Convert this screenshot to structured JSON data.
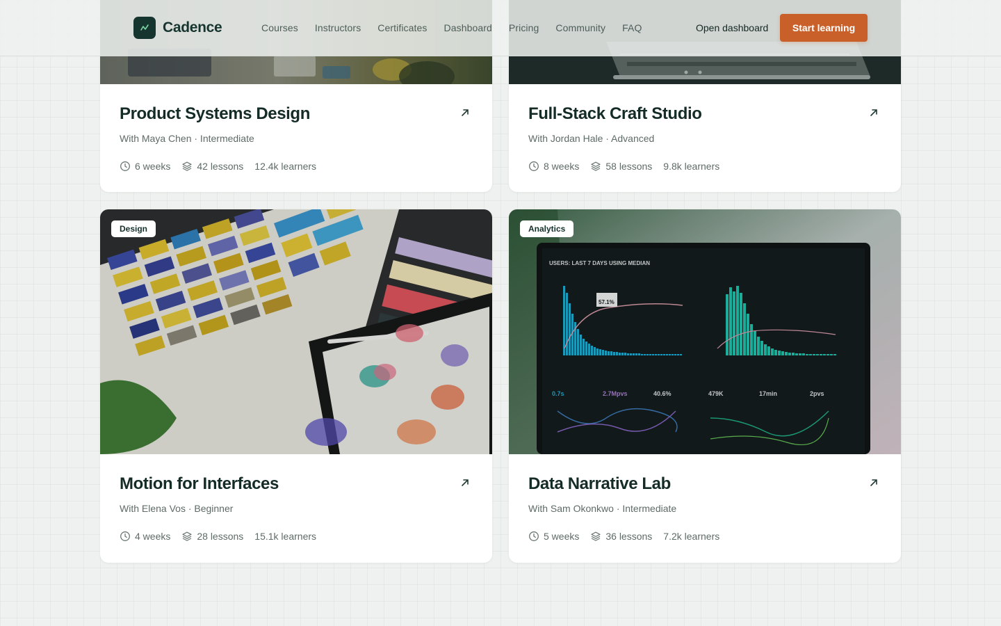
{
  "brand": {
    "name": "Cadence"
  },
  "nav": {
    "items": [
      "Courses",
      "Instructors",
      "Certificates",
      "Dashboard",
      "Pricing",
      "Community",
      "FAQ"
    ],
    "open_dashboard": "Open dashboard",
    "start_learning": "Start learning"
  },
  "colors": {
    "accent": "#c9602a",
    "brand_dark": "#16352f"
  },
  "icons": {
    "duration": "clock-icon",
    "lessons": "layers-icon",
    "open": "arrow-up-right-icon"
  },
  "courses": [
    {
      "title": "Product Systems Design",
      "subtitle": "With Maya Chen · Intermediate",
      "duration": "6 weeks",
      "lessons": "42 lessons",
      "learners": "12.4k learners"
    },
    {
      "title": "Full-Stack Craft Studio",
      "subtitle": "With Jordan Hale · Advanced",
      "duration": "8 weeks",
      "lessons": "58 lessons",
      "learners": "9.8k learners"
    },
    {
      "title": "Motion for Interfaces",
      "subtitle": "With Elena Vos · Beginner",
      "tag": "Design",
      "duration": "4 weeks",
      "lessons": "28 lessons",
      "learners": "15.1k learners"
    },
    {
      "title": "Data Narrative Lab",
      "subtitle": "With Sam Okonkwo · Intermediate",
      "tag": "Analytics",
      "duration": "5 weeks",
      "lessons": "36 lessons",
      "learners": "7.2k learners"
    }
  ],
  "dashboard_screen": {
    "heading": "USERS: LAST 7 DAYS USING MEDIAN",
    "callout": "57.1%",
    "stats": [
      "0.7s",
      "2.7Mpvs",
      "40.6%",
      "479K",
      "17min",
      "2pvs"
    ]
  }
}
